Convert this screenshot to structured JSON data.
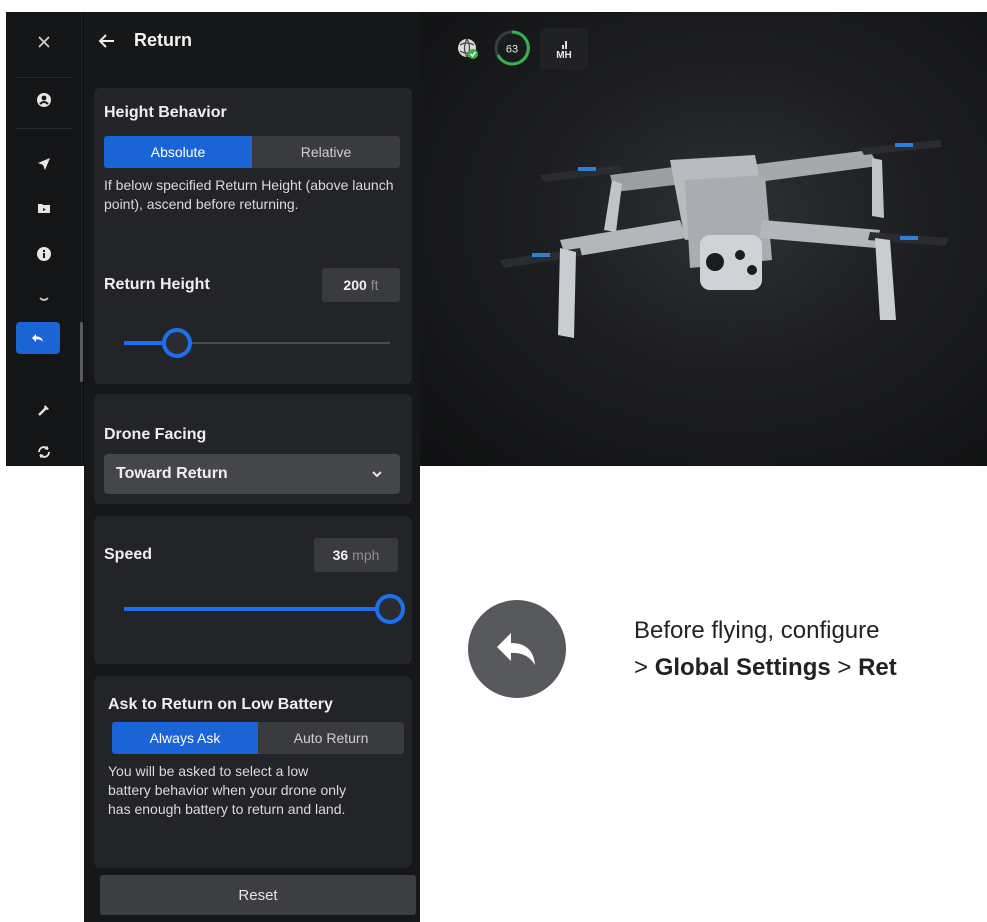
{
  "panel": {
    "title": "Return"
  },
  "height_behavior": {
    "title": "Height Behavior",
    "options": [
      "Absolute",
      "Relative"
    ],
    "selected": "Absolute",
    "description": "If below specified Return Height (above launch point), ascend before returning."
  },
  "return_height": {
    "label": "Return Height",
    "value": "200",
    "unit": "ft",
    "slider_fraction": 0.2
  },
  "drone_facing": {
    "title": "Drone Facing",
    "selected": "Toward Return"
  },
  "speed": {
    "label": "Speed",
    "value": "36",
    "unit": "mph",
    "slider_fraction": 1.0
  },
  "low_battery": {
    "title": "Ask to Return on Low Battery",
    "options": [
      "Always Ask",
      "Auto Return"
    ],
    "selected": "Always Ask",
    "description": "You will be asked to select a low battery behavior when your drone only has enough battery to return and land."
  },
  "reset_label": "Reset",
  "status": {
    "gps_icon": "globe-check-icon",
    "battery_value": "63",
    "signal_label": "MH"
  },
  "rail_icons": [
    "close-icon",
    "account-icon",
    "navigation-arrow-icon",
    "media-folder-icon",
    "info-icon",
    "chevron-icon",
    "return-icon",
    "tools-icon",
    "sync-icon"
  ],
  "hint": {
    "prefix": "Before flying, configure",
    "sep1": ">",
    "global_settings": "Global Settings",
    "sep2": ">",
    "return": "Ret"
  },
  "colors": {
    "accent": "#1a64d6",
    "panel_bg": "#161719",
    "card_bg": "#232427"
  }
}
